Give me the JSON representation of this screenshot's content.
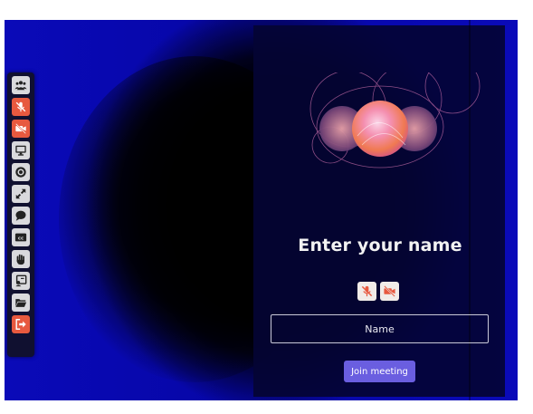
{
  "toolbar": {
    "items": [
      {
        "icon": "participants-icon",
        "color": "#d9d9dd"
      },
      {
        "icon": "microphone-muted-icon",
        "color": "#e7593f"
      },
      {
        "icon": "camera-off-icon",
        "color": "#e7593f"
      },
      {
        "icon": "screen-share-icon",
        "color": "#d9d9dd"
      },
      {
        "icon": "record-icon",
        "color": "#d9d9dd"
      },
      {
        "icon": "fullscreen-icon",
        "color": "#d9d9dd"
      },
      {
        "icon": "chat-icon",
        "color": "#d9d9dd"
      },
      {
        "icon": "captions-icon",
        "color": "#d9d9dd"
      },
      {
        "icon": "raise-hand-icon",
        "color": "#d9d9dd"
      },
      {
        "icon": "whiteboard-icon",
        "color": "#d9d9dd"
      },
      {
        "icon": "folder-icon",
        "color": "#d9d9dd"
      },
      {
        "icon": "leave-icon",
        "color": "#e7593f"
      }
    ],
    "captions_text": "cc"
  },
  "join": {
    "title": "Enter your name",
    "name_placeholder": "Name",
    "name_value": "",
    "button_label": "Join meeting",
    "accent": "#6a5ee0"
  },
  "colors": {
    "background": "#0a0ab8",
    "panel": "#040434",
    "danger": "#e7593f"
  }
}
